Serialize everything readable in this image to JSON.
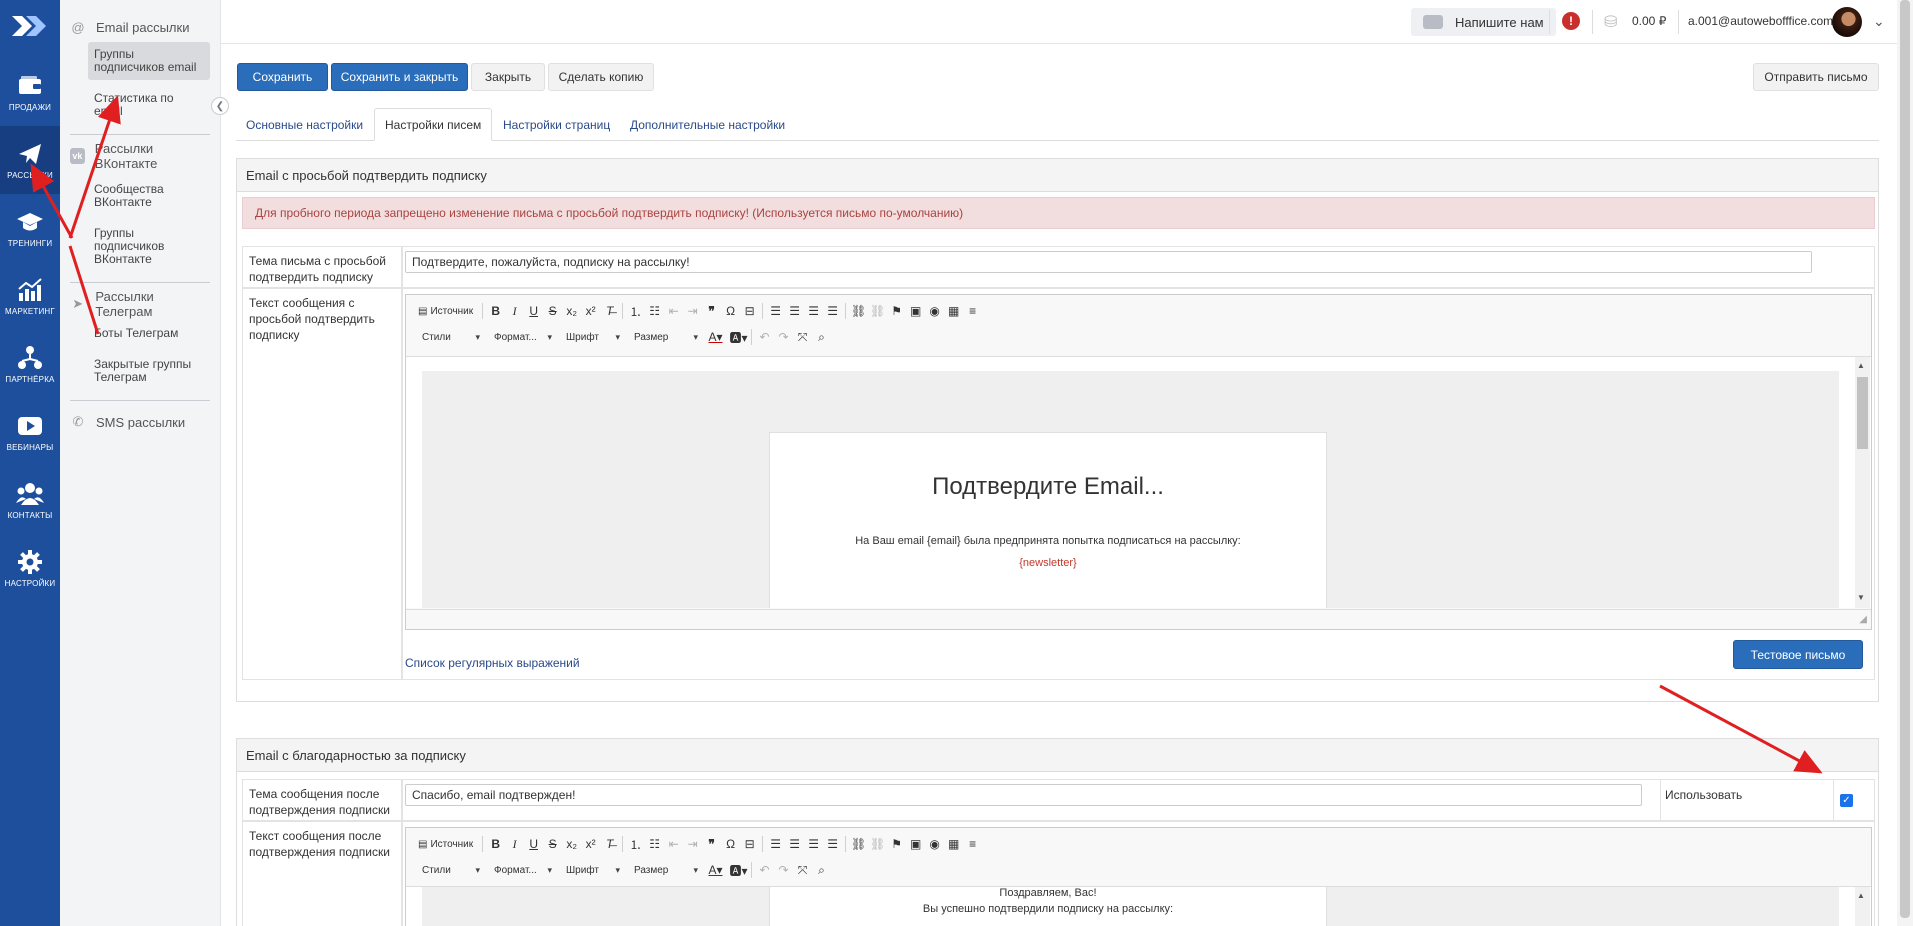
{
  "rail": {
    "items": [
      {
        "label": "ПРОДАЖИ",
        "icon": "wallet-icon"
      },
      {
        "label": "РАССЫЛКИ",
        "icon": "paper-plane-icon"
      },
      {
        "label": "ТРЕНИНГИ",
        "icon": "graduation-cap-icon"
      },
      {
        "label": "МАРКЕТИНГ",
        "icon": "growth-chart-icon"
      },
      {
        "label": "ПАРТНЁРКА",
        "icon": "network-icon"
      },
      {
        "label": "ВЕБИНАРЫ",
        "icon": "play-icon"
      },
      {
        "label": "КОНТАКТЫ",
        "icon": "users-icon"
      },
      {
        "label": "НАСТРОЙКИ",
        "icon": "gear-icon"
      }
    ]
  },
  "subnav": {
    "email_group": "Email рассылки",
    "email_links": [
      "Группы подписчиков email",
      "Статистика по email"
    ],
    "vk_group": "Рассылки ВКонтакте",
    "vk_links": [
      "Сообщества ВКонтакте",
      "Группы подписчиков ВКонтакте"
    ],
    "tg_group": "Рассылки Телеграм",
    "tg_links": [
      "Боты Телеграм",
      "Закрытые группы Телеграм"
    ],
    "sms_group": "SMS рассылки"
  },
  "topbar": {
    "message_button": "Напишите нам",
    "balance": "0.00 ₽",
    "user_email": "a.001@autowebofffice.com"
  },
  "toolbar": {
    "save": "Сохранить",
    "save_close": "Сохранить и закрыть",
    "close": "Закрыть",
    "copy": "Сделать копию",
    "send_letter": "Отправить письмо"
  },
  "tabs": [
    "Основные настройки",
    "Настройки писем",
    "Настройки страниц",
    "Дополнительные настройки"
  ],
  "confirm_section": {
    "title": "Email с просьбой подтвердить подписку",
    "warning": "Для пробного периода запрещено изменение письма с просьбой подтвердить подписку! (Используется письмо по-умолчанию)",
    "subject_label": "Тема письма с просьбой подтвердить подписку",
    "subject_value": "Подтвердите, пожалуйста, подписку на рассылку!",
    "body_label": "Текст сообщения с просьбой подтвердить подписку",
    "email_heading": "Подтвердите Email...",
    "email_text": "На Ваш email {email} была предпринята попытка подписаться на рассылку:",
    "email_var": "{newsletter}",
    "regex_link": "Список регулярных выражений",
    "test_button": "Тестовое письмо"
  },
  "thanks_section": {
    "title": "Email с благодарностью за подписку",
    "subject_label": "Тема сообщения после подтверждения подписки",
    "subject_value": "Спасибо, email подтвержден!",
    "use_label": "Использовать",
    "use_checked": true,
    "body_label": "Текст сообщения после подтверждения подписки",
    "email_line1": "Поздравляем, Вас!",
    "email_line2": "Вы успешно подтвердили подписку на рассылку:"
  },
  "editor": {
    "source_label": "Источник",
    "styles": "Стили",
    "format": "Формат...",
    "font": "Шрифт",
    "size": "Размер"
  },
  "colors": {
    "rail": "#1e4f9c",
    "primary": "#2a6ebb",
    "warning_bg": "#f2dede",
    "annotation_arrow": "#e02020"
  }
}
